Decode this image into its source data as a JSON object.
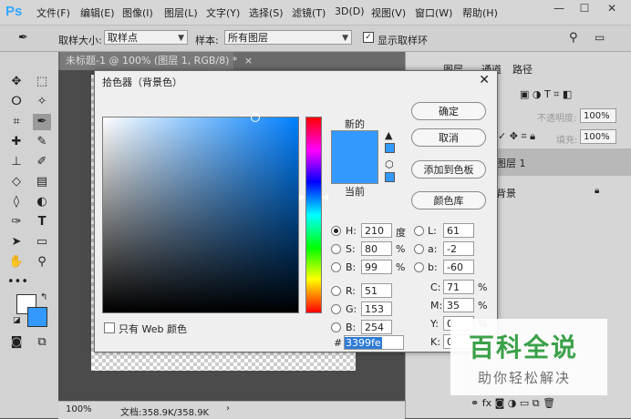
{
  "app": {
    "logo": "Ps"
  },
  "menu": [
    "文件(F)",
    "编辑(E)",
    "图像(I)",
    "图层(L)",
    "文字(Y)",
    "选择(S)",
    "滤镜(T)",
    "3D(D)",
    "视图(V)",
    "窗口(W)",
    "帮助(H)"
  ],
  "window_controls": {
    "minimize": "—",
    "restore": "☐",
    "close": "✕"
  },
  "options": {
    "sample_size_label": "取样大小:",
    "sample_size_value": "取样点",
    "sample_label": "样本:",
    "sample_value": "所有图层",
    "show_ring_label": "显示取样环"
  },
  "document": {
    "tab_title": "未标题-1 @ 100% (图层 1, RGB/8) *",
    "tab_close": "×"
  },
  "status": {
    "zoom": "100%",
    "doc_info": "文档:358.9K/358.9K",
    "arrow": "›"
  },
  "right_panel": {
    "tabs": [
      "图层",
      "通道",
      "路径"
    ],
    "opacity_label": "不透明度:",
    "opacity_value": "100%",
    "fill_label": "填充:",
    "fill_value": "100%",
    "layers": [
      "图层 1",
      "背景"
    ]
  },
  "dialog": {
    "title": "拾色器（背景色）",
    "close": "✕",
    "new_label": "新的",
    "current_label": "当前",
    "buttons": {
      "ok": "确定",
      "cancel": "取消",
      "add_swatch": "添加到色板",
      "color_lib": "颜色库"
    },
    "hsb": {
      "H": "210",
      "H_unit": "度",
      "S": "80",
      "S_unit": "%",
      "B": "99",
      "B_unit": "%"
    },
    "rgb": {
      "R": "51",
      "G": "153",
      "B": "254"
    },
    "lab": {
      "L": "61",
      "a": "-2",
      "b": "-60"
    },
    "cmyk": {
      "C": "71",
      "C_unit": "%",
      "M": "35",
      "M_unit": "%",
      "Y": "0",
      "Y_unit": "%",
      "K": "0",
      "K_unit": "%"
    },
    "hex_label": "#",
    "hex": "3399fe",
    "web_only_label": "只有 Web 颜色",
    "color_new": "#3399fe",
    "color_current": "#3399fe"
  },
  "watermark": {
    "main": "百科全说",
    "sub": "助你轻松解决"
  }
}
